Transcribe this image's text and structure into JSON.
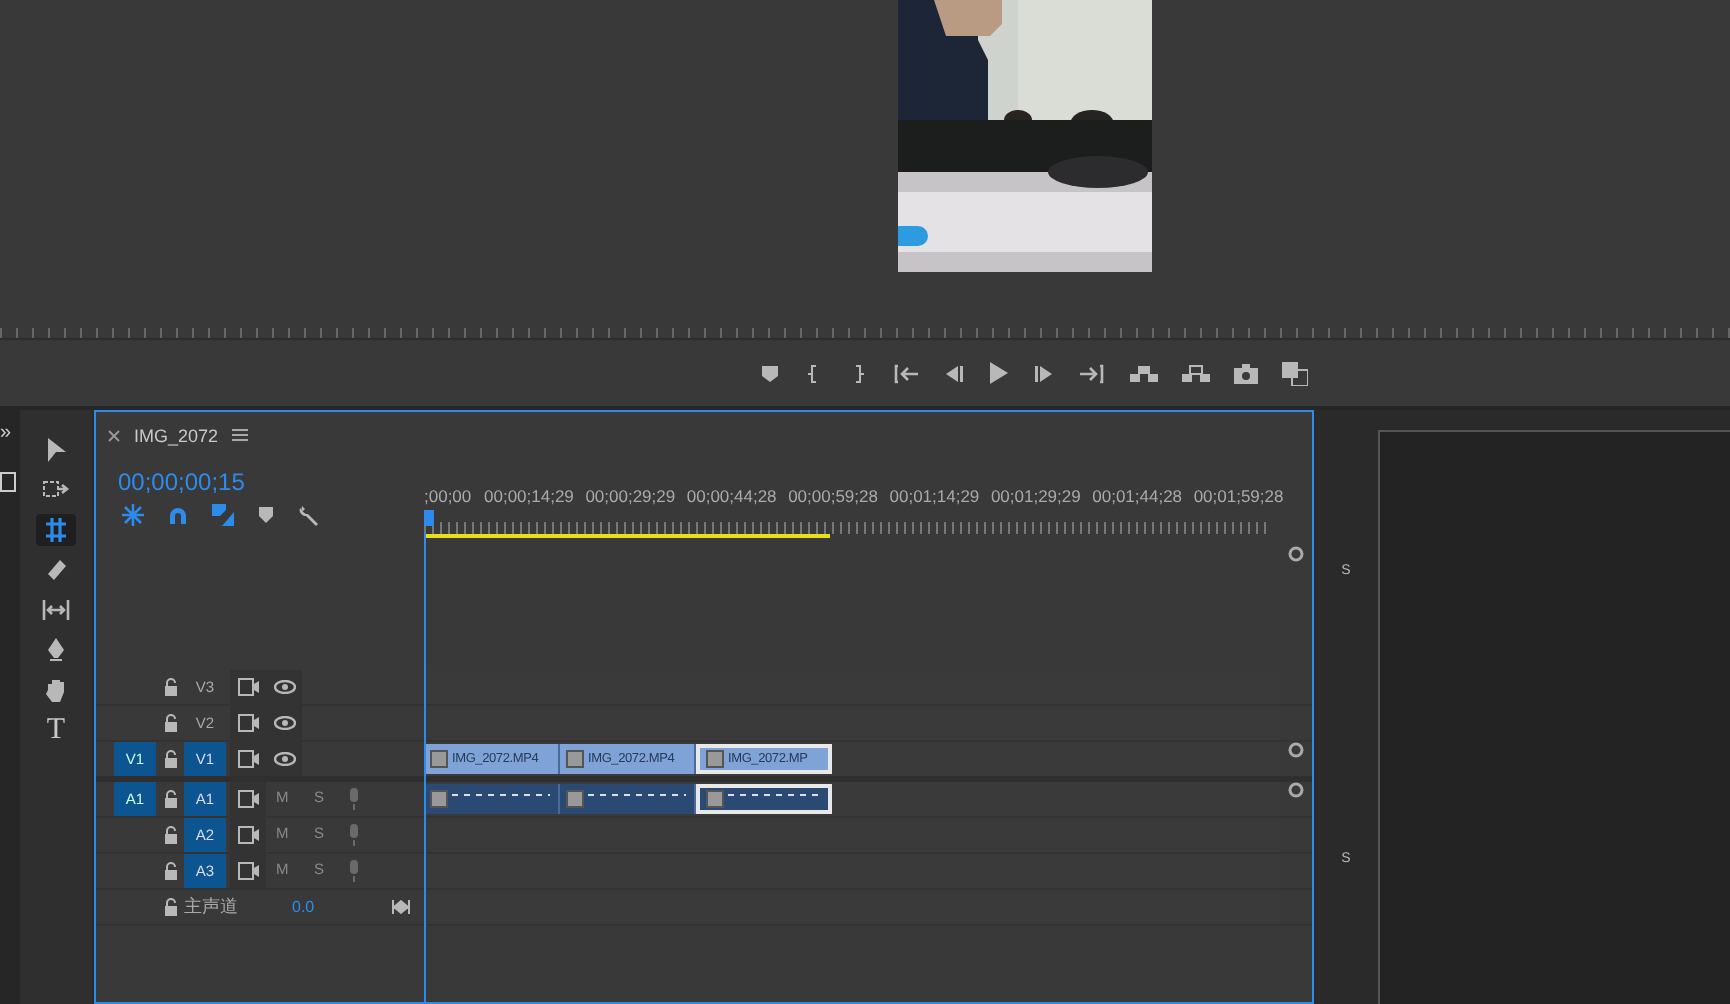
{
  "monitor": {
    "picture": {
      "kind": "picture"
    }
  },
  "tools_strip": {
    "expand_glyph": "»"
  },
  "tools": [
    {
      "kind": "selection",
      "selected": false
    },
    {
      "kind": "track_select",
      "selected": false
    },
    {
      "kind": "ripple",
      "selected": true
    },
    {
      "kind": "razor",
      "selected": false
    },
    {
      "kind": "slip",
      "selected": false
    },
    {
      "kind": "pen",
      "selected": false
    },
    {
      "kind": "hand",
      "selected": false
    },
    {
      "kind": "type",
      "glyph": "T",
      "selected": false
    }
  ],
  "sequence": {
    "title": "IMG_2072",
    "timecode": "00;00;00;15"
  },
  "ruler": {
    "labels": [
      ";00;00",
      "00;00;14;29",
      "00;00;29;29",
      "00;00;44;28",
      "00;00;59;28",
      "00;01;14;29",
      "00;01;29;29",
      "00;01;44;28",
      "00;01;59;28"
    ],
    "work_area": {
      "level": 0.48
    }
  },
  "tracks": [
    {
      "kind": "video",
      "label": "V3",
      "targeted": false
    },
    {
      "kind": "video",
      "label": "V2",
      "targeted": false
    },
    {
      "kind": "video",
      "label": "V1",
      "source_patch": "V1",
      "targeted": true,
      "clips": [
        {
          "label": "IMG_2072.MP4",
          "selected": false
        },
        {
          "label": "IMG_2072.MP4",
          "selected": false
        },
        {
          "label": "IMG_2072.MP",
          "selected": true
        }
      ]
    },
    {
      "kind": "audio",
      "label": "A1",
      "source_patch": "A1",
      "targeted": true,
      "mute": "M",
      "solo": "S",
      "clips": [
        {
          "selected": false
        },
        {
          "selected": false
        },
        {
          "selected": true
        }
      ]
    },
    {
      "kind": "audio",
      "label": "A2",
      "targeted": true,
      "mute": "M",
      "solo": "S"
    },
    {
      "kind": "audio",
      "label": "A3",
      "targeted": true,
      "mute": "M",
      "solo": "S"
    },
    {
      "kind": "master",
      "label": "主声道",
      "value": "0.0"
    }
  ],
  "side_labels": [
    "S",
    "S"
  ]
}
